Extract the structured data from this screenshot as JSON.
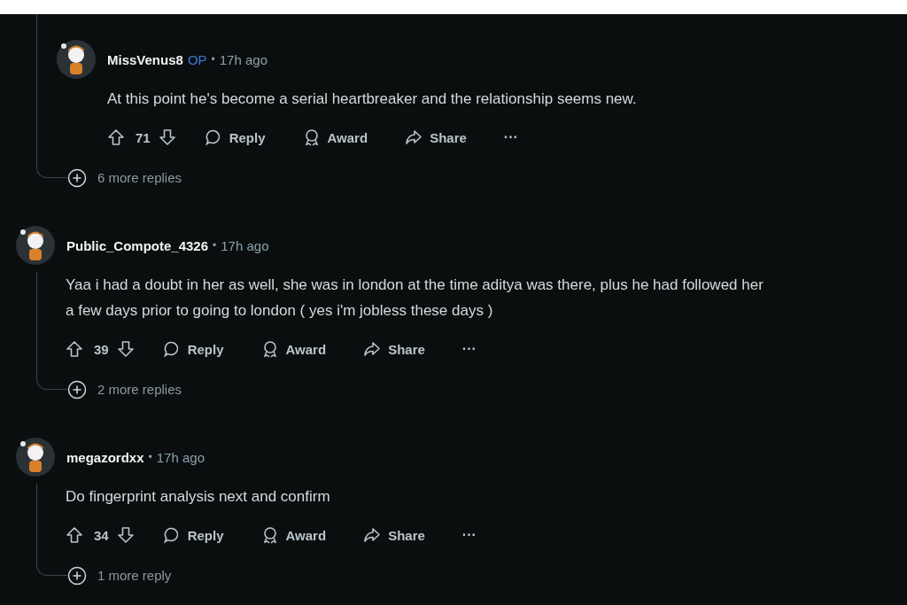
{
  "comments": [
    {
      "kind": "reply",
      "author": "MissVenus8",
      "flair": "OP",
      "separator": "•",
      "time": "17h ago",
      "body": "At this point he's become a serial heartbreaker and the relationship seems new.",
      "score": "71",
      "actions": [
        {
          "kind": "reply",
          "label": "Reply"
        },
        {
          "kind": "award",
          "label": "Award"
        },
        {
          "kind": "share",
          "label": "Share"
        },
        {
          "kind": "more",
          "label": "···"
        }
      ],
      "more_replies": "6 more replies"
    },
    {
      "kind": "top",
      "author": "Public_Compote_4326",
      "separator": "•",
      "time": "17h ago",
      "body": "Yaa i had a doubt in her as well, she was in london at the time aditya was there, plus he had followed her a few days prior to going to london ( yes i'm jobless these days )",
      "score": "39",
      "actions": [
        {
          "kind": "reply",
          "label": "Reply"
        },
        {
          "kind": "award",
          "label": "Award"
        },
        {
          "kind": "share",
          "label": "Share"
        },
        {
          "kind": "more",
          "label": "···"
        }
      ],
      "more_replies": "2 more replies"
    },
    {
      "kind": "top",
      "author": "megazordxx",
      "separator": "•",
      "time": "17h ago",
      "body": "Do fingerprint analysis next and confirm",
      "score": "34",
      "actions": [
        {
          "kind": "reply",
          "label": "Reply"
        },
        {
          "kind": "award",
          "label": "Award"
        },
        {
          "kind": "share",
          "label": "Share"
        },
        {
          "kind": "more",
          "label": "···"
        }
      ],
      "more_replies": "1 more reply"
    }
  ]
}
